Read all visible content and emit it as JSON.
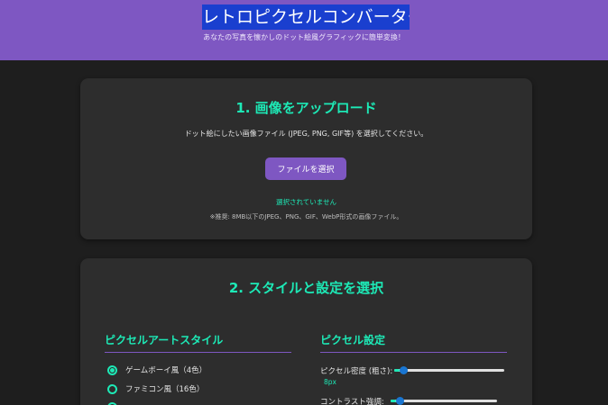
{
  "header": {
    "title": "レトロピクセルコンバーター",
    "subtitle": "あなたの写真を懐かしのドット絵風グラフィックに簡単変換！"
  },
  "upload": {
    "title": "1.  画像をアップロード",
    "description": "ドット絵にしたい画像ファイル (JPEG, PNG, GIF等) を選択してください。",
    "button_label": "ファイルを選択",
    "status": "選択されていません",
    "hint": "※推奨: 8MB以下のJPEG、PNG、GIF、WebP形式の画像ファイル。"
  },
  "settings": {
    "title": "2.  スタイルと設定を選択",
    "style_heading": "ピクセルアートスタイル",
    "styles": [
      {
        "label": "ゲームボーイ風（4色）",
        "selected": true
      },
      {
        "label": "ファミコン風（16色）",
        "selected": false
      },
      {
        "label": "",
        "selected": false
      }
    ],
    "pixel_heading": "ピクセル設定",
    "density_label": "ピクセル密度 (粗さ):",
    "density_value": "8px",
    "density_level": 0.05,
    "contrast_label": "コントラスト強調:",
    "contrast_level": 0.05
  },
  "colors": {
    "accent": "#7e57c2",
    "teal": "#1de9b6",
    "card": "#2d2d2d",
    "background": "#1e1e1e"
  }
}
